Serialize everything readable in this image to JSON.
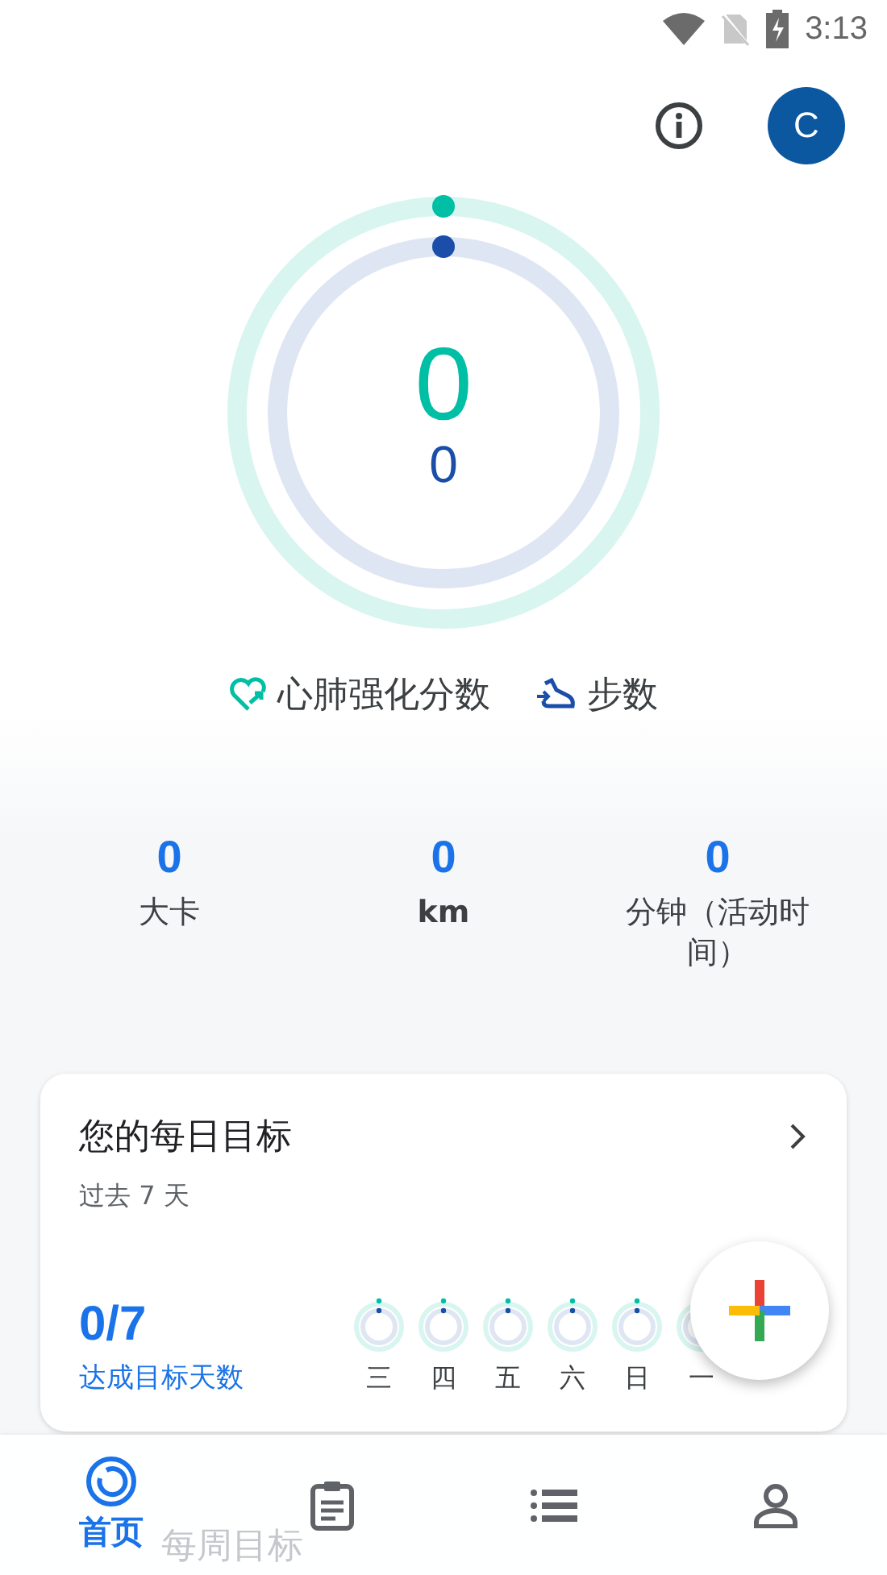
{
  "status_bar": {
    "time": "3:13"
  },
  "header": {
    "avatar_letter": "C"
  },
  "rings": {
    "heart_points": "0",
    "steps": "0"
  },
  "legend": [
    {
      "kind": "heart",
      "label": "心肺强化分数"
    },
    {
      "kind": "steps",
      "label": "步数"
    }
  ],
  "stats": [
    {
      "value": "0",
      "label": "大卡",
      "bold": false
    },
    {
      "value": "0",
      "label": "km",
      "bold": true
    },
    {
      "value": "0",
      "label": "分钟（活动时间）",
      "bold": false
    }
  ],
  "daily_goals": {
    "title": "您的每日目标",
    "subtitle": "过去 7 天",
    "achieved": "0/7",
    "achieved_label": "达成目标天数",
    "days": [
      {
        "label": "三"
      },
      {
        "label": "四"
      },
      {
        "label": "五"
      },
      {
        "label": "六"
      },
      {
        "label": "日"
      },
      {
        "label": "一"
      }
    ]
  },
  "next_card": {
    "title": "每周目标"
  },
  "nav": [
    {
      "kind": "home",
      "label": "首页",
      "selected": true
    },
    {
      "kind": "journal",
      "selected": false
    },
    {
      "kind": "browse",
      "selected": false
    },
    {
      "kind": "profile",
      "selected": false
    }
  ]
}
